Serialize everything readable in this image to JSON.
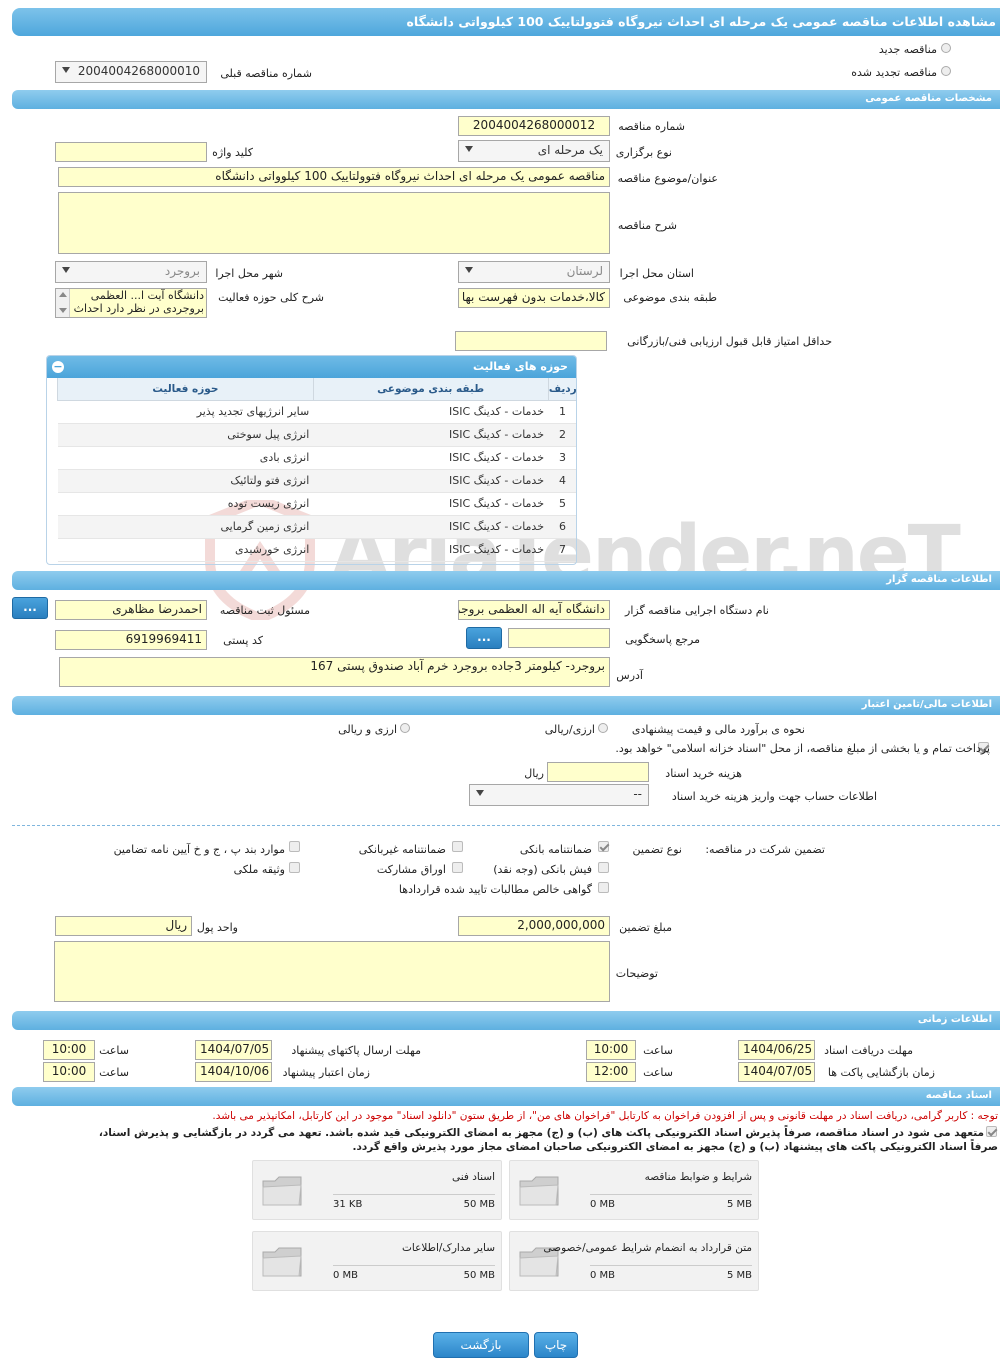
{
  "title": "مشاهده اطلاعات مناقصه عمومی یک مرحله ای احداث نیروگاه فتوولتاییک 100 کیلوواتی دانشگاه",
  "top": {
    "new_tender": "مناقصه جدید",
    "renewed_tender": "مناقصه تجدید شده",
    "prev_number_label": "شماره مناقصه قبلی",
    "prev_number_value": "2004004268000010"
  },
  "general": {
    "header": "مشخصات مناقصه عمومی",
    "number_label": "شماره مناقصه",
    "number_value": "2004004268000012",
    "type_label": "نوع برگزاری",
    "type_value": "یک مرحله ای",
    "keyword_label": "کلید واژه",
    "keyword_value": "",
    "subject_label": "عنوان/موضوع مناقصه",
    "subject_value": "مناقصه عمومی یک مرحله ای احداث نیروگاه فتوولتاییک 100 کیلوواتی دانشگاه",
    "desc_label": "شرح مناقصه",
    "desc_value": "",
    "province_label": "استان محل اجرا",
    "province_value": "لرستان",
    "city_label": "شهر محل اجرا",
    "city_value": "بروجرد",
    "category_label": "طبقه بندی موضوعی",
    "category_value": "کالا،خدمات بدون فهرست بها",
    "activity_desc_label": "شرح کلی حوزه فعالیت",
    "activity_desc_line1": "دانشگاه آیت ا... العظمی",
    "activity_desc_line2": "بروجردی در نظر دارد احداث",
    "min_score_label": "حداقل امتیاز قابل قبول ارزیابی فنی/بازرگانی",
    "min_score_value": ""
  },
  "activities": {
    "header": "حوزه های فعالیت",
    "col_row": "ردیف",
    "col_category": "طبقه بندی موضوعی",
    "col_field": "حوزه فعالیت",
    "rows": [
      {
        "n": "1",
        "cat": "خدمات - کدینگ ISIC",
        "field": "سایر انرژیهای تجدید پذیر"
      },
      {
        "n": "2",
        "cat": "خدمات - کدینگ ISIC",
        "field": "انرژی پیل سوختی"
      },
      {
        "n": "3",
        "cat": "خدمات - کدینگ ISIC",
        "field": "انرژی بادی"
      },
      {
        "n": "4",
        "cat": "خدمات - کدینگ ISIC",
        "field": "انرژی فتو ولتائیک"
      },
      {
        "n": "5",
        "cat": "خدمات - کدینگ ISIC",
        "field": "انرژی زیست توده"
      },
      {
        "n": "6",
        "cat": "خدمات - کدینگ ISIC",
        "field": "انرژی زمین گرمایی"
      },
      {
        "n": "7",
        "cat": "خدمات - کدینگ ISIC",
        "field": "انرژی خورشیدی"
      }
    ]
  },
  "organizer": {
    "header": "اطلاعات مناقصه گزار",
    "org_label": "نام دستگاه اجرایی مناقصه گزار",
    "org_value": "دانشگاه آیه اله العظمی بروجردی",
    "officer_label": "مسئول ثبت مناقصه",
    "officer_value": "احمدرضا مظاهری",
    "ref_label": "مرجع پاسخگویی",
    "ref_value": "",
    "postal_label": "کد پستی",
    "postal_value": "6919969411",
    "address_label": "آدرس",
    "address_value": "بروجرد- کیلومتر 3جاده  بروجرد خرم آباد صندوق پستی 167",
    "more_btn": "..."
  },
  "finance": {
    "header": "اطلاعات مالی/تامین اعتبار",
    "estimate_label": "نحوه ی برآورد مالی و قیمت پیشنهادی",
    "opt_fx_rial": "ارزی/ریالی",
    "opt_fx_and_rial": "ارزی و ریالی",
    "treasury_note": "پرداخت تمام و یا بخشی از مبلغ مناقصه، از محل \"اسناد خزانه اسلامی\" خواهد بود.",
    "doc_cost_label": "هزینه خرید اسناد",
    "doc_cost_value": "",
    "doc_cost_unit": "ریال",
    "account_label": "اطلاعات حساب جهت واریز هزینه خرید اسناد",
    "account_value": "--"
  },
  "guarantee": {
    "main_label": "تضمین شرکت در مناقصه:",
    "type_label": "نوع تضمین",
    "bank_guarantee": "ضمانتنامه بانکی",
    "nonbank_guarantee": "ضمانتنامه غیربانکی",
    "clauses": "موارد بند پ ، ج و خ آیین نامه تضامین",
    "bank_receipt": "فیش بانکی (وجه نقد)",
    "bonds": "اوراق مشارکت",
    "property": "وثیقه ملکی",
    "claims": "گواهی خالص مطالبات تایید شده قراردادها",
    "amount_label": "مبلغ تضمین",
    "amount_value": "2,000,000,000",
    "currency_label": "واحد پول",
    "currency_value": "ریال",
    "notes_label": "توضیحات",
    "notes_value": ""
  },
  "timing": {
    "header": "اطلاعات زمانی",
    "doc_deadline_label": "مهلت دریافت اسناد",
    "doc_deadline_date": "1404/06/25",
    "doc_deadline_time": "10:00",
    "send_deadline_label": "مهلت ارسال پاکتهای پیشنهاد",
    "send_deadline_date": "1404/07/05",
    "send_deadline_time": "10:00",
    "opening_label": "زمان بازگشایی پاکت ها",
    "opening_date": "1404/07/05",
    "opening_time": "12:00",
    "validity_label": "زمان اعتبار پیشنهاد",
    "validity_date": "1404/10/06",
    "validity_time": "10:00",
    "time_label": "ساعت"
  },
  "docs": {
    "header": "اسناد مناقصه",
    "note": "توجه : کاربر گرامی، دریافت اسناد در مهلت قانونی و پس از افزودن فراخوان به کارتابل \"فراخوان های من\"، از طریق ستون \"دانلود اسناد\" موجود در این کارتابل، امکانپذیر می باشد.",
    "commit_line1": "متعهد می شود در اسناد مناقصه، صرفاً پذیرش اسناد الکترونیکی پاکت های (ب) و (ج) مجهز به امضای الکترونیکی قید شده باشد. تعهد می گردد در بازگشایی و پذیرش اسناد،",
    "commit_line2": "صرفاً اسناد الکترونیکی پاکت های پیشنهاد (ب) و (ج) مجهز به امضای الکترونیکی صاحبان امضای مجاز مورد پذیرش واقع گردد.",
    "files": [
      {
        "title": "شرایط و ضوابط مناقصه",
        "max": "5 MB",
        "size": "0 MB"
      },
      {
        "title": "اسناد فنی",
        "max": "50 MB",
        "size": "31 KB"
      },
      {
        "title": "متن قرارداد به انضمام شرایط عمومی/خصوصی",
        "max": "5 MB",
        "size": "0 MB"
      },
      {
        "title": "سایر مدارک/اطلاعات",
        "max": "50 MB",
        "size": "0 MB"
      }
    ]
  },
  "buttons": {
    "print": "چاپ",
    "back": "بازگشت"
  },
  "watermark": "AriaTender.neT",
  "colors": {
    "header_blue": "#5eb0e0",
    "input_yellow": "#ffffcc",
    "alert_red": "#cc0000"
  }
}
